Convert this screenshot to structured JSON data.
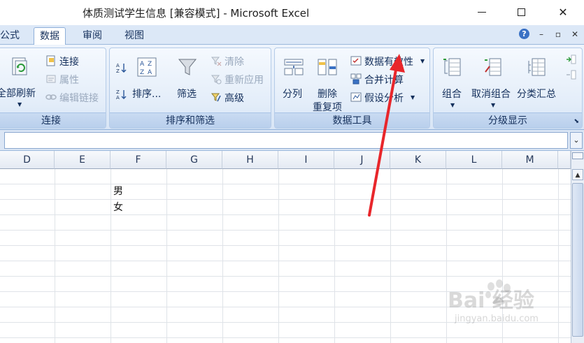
{
  "window": {
    "title": "体质测试学生信息  [兼容模式] - Microsoft Excel"
  },
  "tabs": [
    {
      "label": "公式",
      "active": false
    },
    {
      "label": "数据",
      "active": true
    },
    {
      "label": "审阅",
      "active": false
    },
    {
      "label": "视图",
      "active": false
    }
  ],
  "ribbon": {
    "connections": {
      "label": "连接",
      "refresh_all": "全部刷新",
      "connections": "连接",
      "properties": "属性",
      "edit_links": "编辑链接"
    },
    "sort_filter": {
      "label": "排序和筛选",
      "sort": "排序...",
      "filter": "筛选",
      "clear": "清除",
      "reapply": "重新应用",
      "advanced": "高级"
    },
    "data_tools": {
      "label": "数据工具",
      "text_to_columns": "分列",
      "remove_dup_line1": "删除",
      "remove_dup_line2": "重复项",
      "data_validation": "数据有效性",
      "consolidate": "合并计算",
      "what_if": "假设分析"
    },
    "outline": {
      "label": "分级显示",
      "group": "组合",
      "ungroup": "取消组合",
      "subtotal": "分类汇总"
    }
  },
  "columns": [
    "D",
    "E",
    "F",
    "G",
    "H",
    "I",
    "J",
    "K",
    "L",
    "M"
  ],
  "cells": {
    "f1": "男",
    "f2": "女"
  },
  "watermark": {
    "brand": "Bai 经验",
    "url": "jingyan.baidu.com"
  },
  "colors": {
    "accent": "#2b579a",
    "arrow": "#e8262b"
  }
}
